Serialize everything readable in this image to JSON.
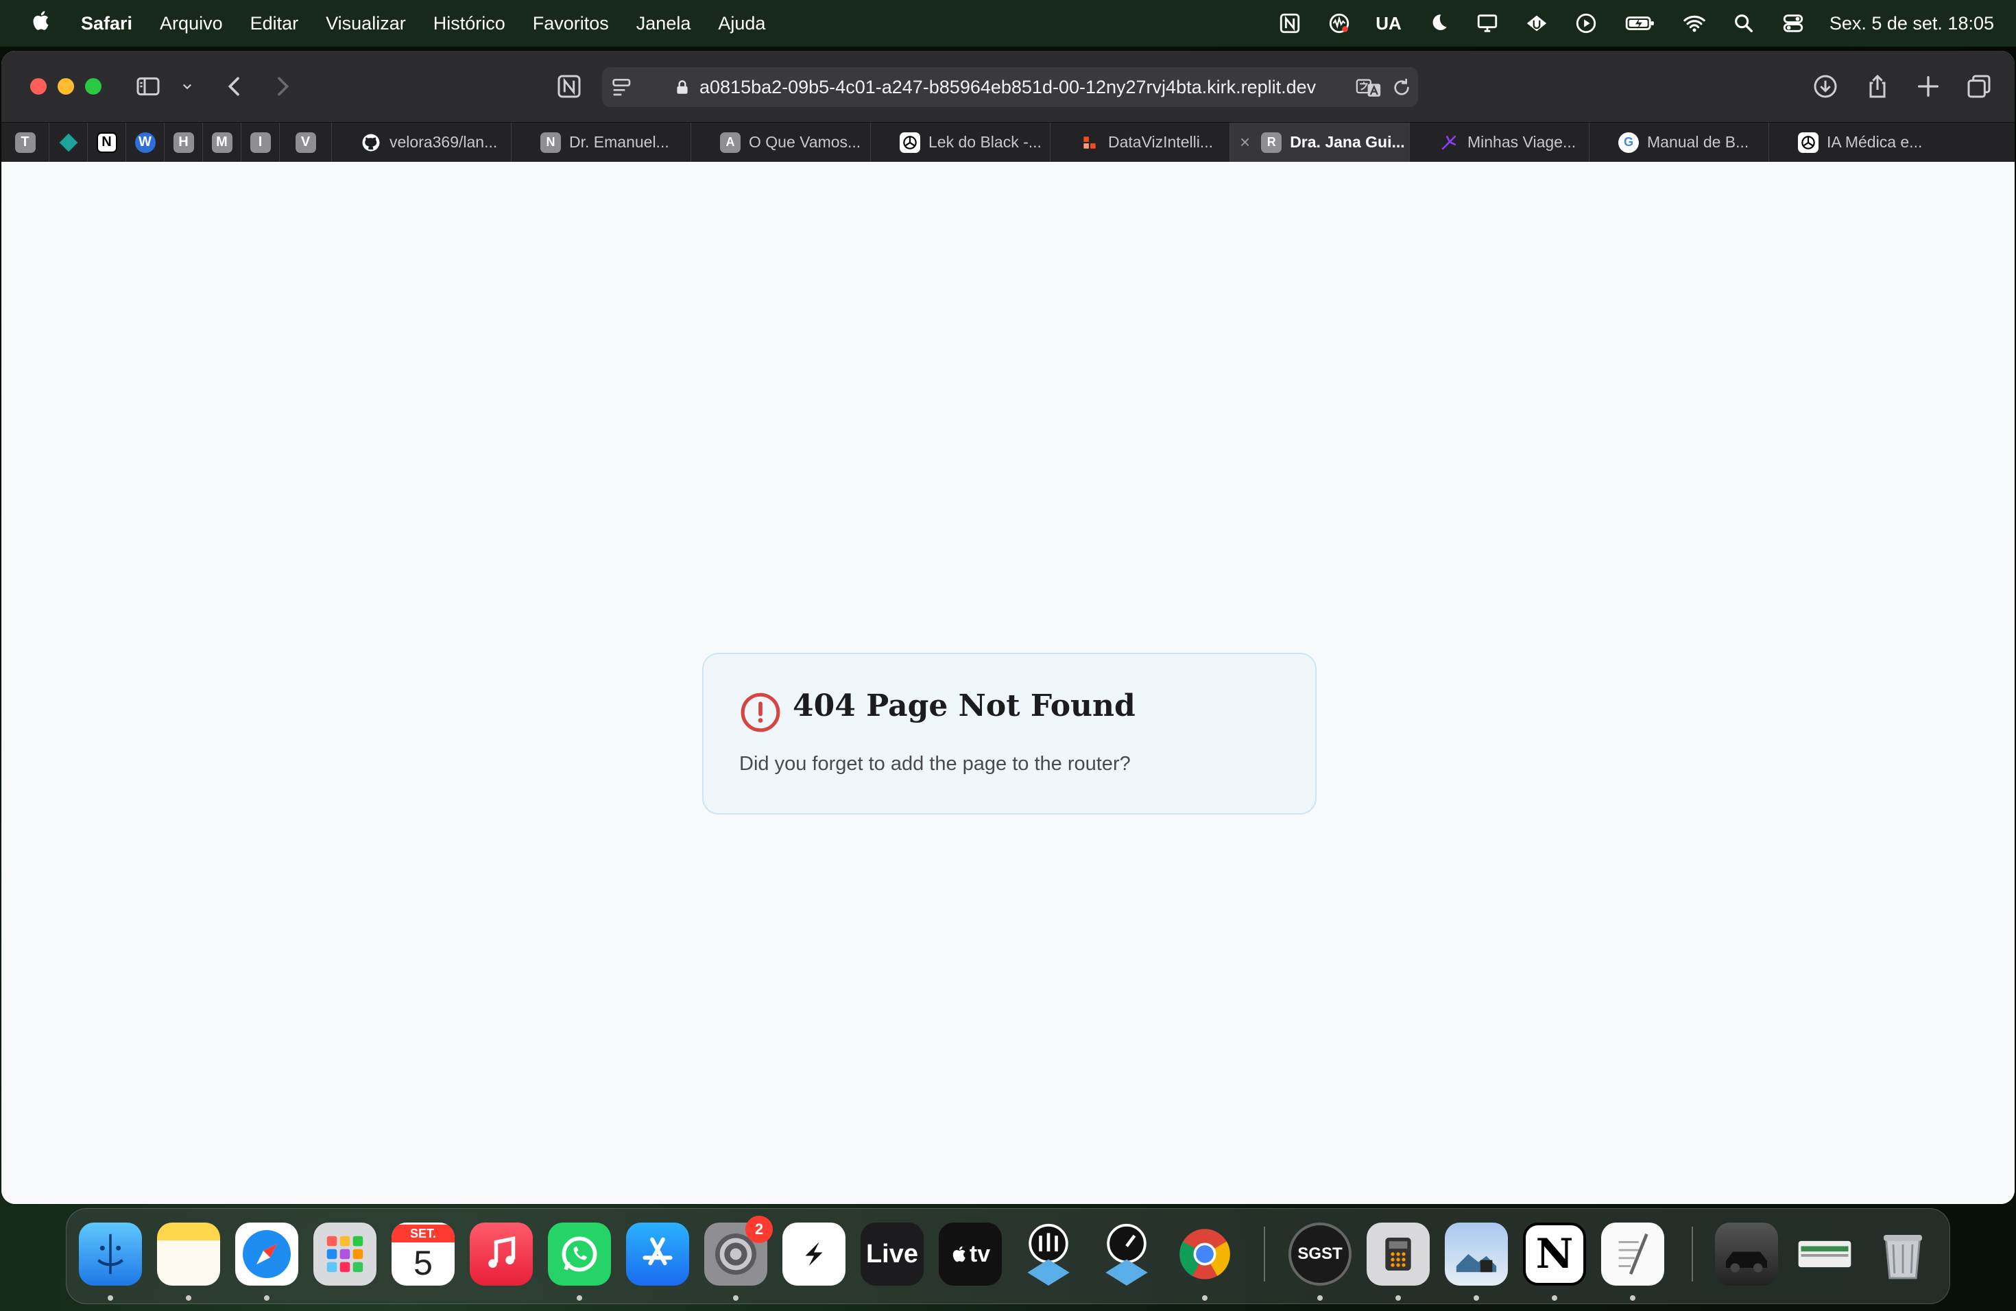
{
  "menubar": {
    "app_name": "Safari",
    "menus": [
      "Arquivo",
      "Editar",
      "Visualizar",
      "Histórico",
      "Favoritos",
      "Janela",
      "Ajuda"
    ],
    "status_text": "UA",
    "clock": "Sex. 5 de set.  18:05"
  },
  "browser": {
    "url": "a0815ba2-09b5-4c01-a247-b85964eb851d-00-12ny27rvj4bta.kirk.replit.dev",
    "pinned_tabs": [
      "T",
      "",
      "N",
      "W",
      "H",
      "M",
      "I",
      "V"
    ],
    "tabs": [
      {
        "label": "velora369/lan...",
        "favicon": "github-icon",
        "color": "#1b1f23",
        "letter": ""
      },
      {
        "label": "Dr. Emanuel...",
        "favicon": "letter",
        "color": "#8e8e93",
        "letter": "N"
      },
      {
        "label": "O Que Vamos...",
        "favicon": "letter",
        "color": "#8e8e93",
        "letter": "A"
      },
      {
        "label": "Lek do Black -...",
        "favicon": "openai-icon",
        "color": "#000000",
        "letter": ""
      },
      {
        "label": "DataVizIntelli...",
        "favicon": "figma-like-icon",
        "color": "#f24e1e",
        "letter": ""
      },
      {
        "label": "Dra. Jana Gui...",
        "favicon": "letter",
        "color": "#8e8e93",
        "letter": "R",
        "active": true
      },
      {
        "label": "Minhas Viage...",
        "favicon": "plane-icon",
        "color": "#6c2bd9",
        "letter": ""
      },
      {
        "label": "Manual de B...",
        "favicon": "letter",
        "color": "#4285f4",
        "letter": "G"
      },
      {
        "label": "IA Médica e...",
        "favicon": "openai-icon",
        "color": "#000000",
        "letter": ""
      }
    ]
  },
  "page": {
    "error_title": "404 Page Not Found",
    "error_message": "Did you forget to add the page to the router?"
  },
  "dock": {
    "calendar_month": "SET.",
    "calendar_day": "5",
    "settings_badge": "2",
    "live_label": "Live",
    "tv_label": "tv",
    "sgst_label": "SGST",
    "notion_label": "N"
  },
  "colors": {
    "card_bg": "#f0f7fa",
    "card_border": "#cfe6f2",
    "error_red": "#d64541"
  }
}
